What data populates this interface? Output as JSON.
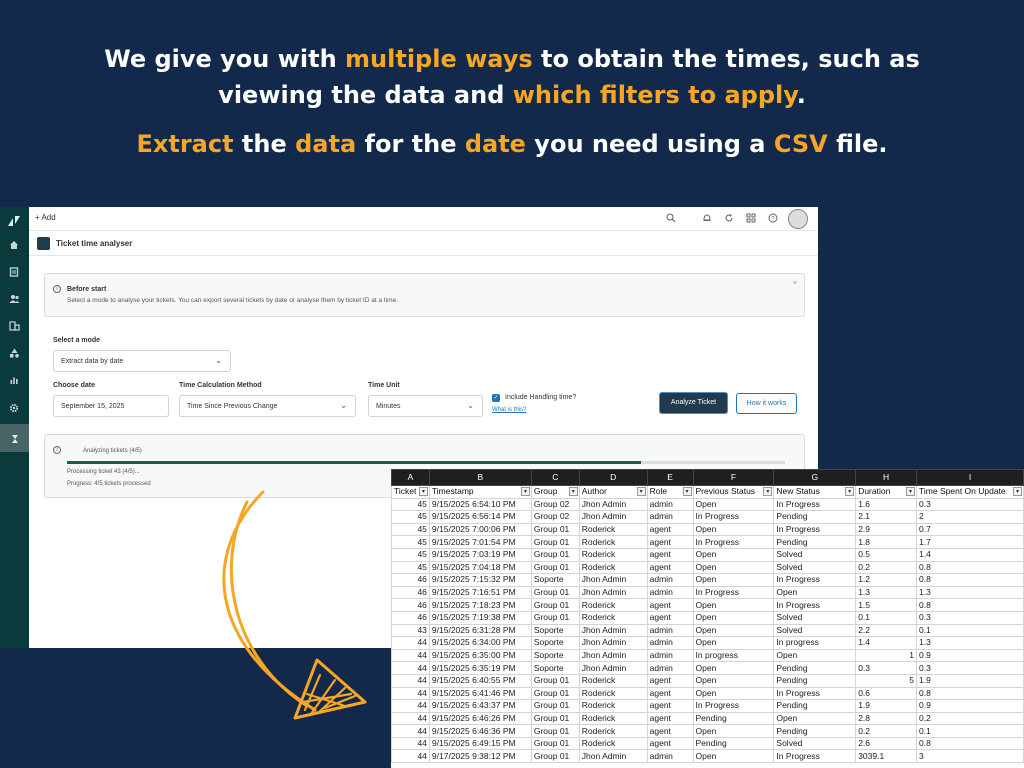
{
  "headline": {
    "line1_parts": [
      {
        "text": "We give you with ",
        "hl": false
      },
      {
        "text": "multiple ways",
        "hl": true
      },
      {
        "text": " to obtain the times, such as viewing the data and ",
        "hl": false
      },
      {
        "text": "which filters to apply",
        "hl": true
      },
      {
        "text": ".",
        "hl": false
      }
    ],
    "line2_parts": [
      {
        "text": "Extract",
        "hl": true
      },
      {
        "text": " the ",
        "hl": false
      },
      {
        "text": "data",
        "hl": true
      },
      {
        "text": " for the ",
        "hl": false
      },
      {
        "text": "date",
        "hl": true
      },
      {
        "text": " you need using a ",
        "hl": false
      },
      {
        "text": "CSV",
        "hl": true
      },
      {
        "text": " file.",
        "hl": false
      }
    ],
    "highlight_color": "#f5a623"
  },
  "app": {
    "add_label": "+ Add",
    "title": "Ticket time analyser",
    "info": {
      "title": "Before start",
      "text": "Select a mode to analyse your tickets. You can export several tickets by date or analyse them by ticket ID at a time.",
      "close": "×"
    },
    "mode": {
      "label": "Select a mode",
      "value": "Extract data by date"
    },
    "date": {
      "label": "Choose date",
      "value": "September 15, 2025"
    },
    "method": {
      "label": "Time Calculation Method",
      "value": "Time Since Previous Change"
    },
    "unit": {
      "label": "Time Unit",
      "value": "Minutes"
    },
    "handling": {
      "label": "Include Handling time?",
      "link": "What is this?",
      "checked": true
    },
    "analyze_button": "Analyze Ticket",
    "how_button": "How it works",
    "progress": {
      "title": "Analyzing tickets (4/5)",
      "processing": "Processing ticket 43 (4/5)...",
      "summary": "Progress: 4/5 tickets processed",
      "fraction": 0.8
    },
    "rail_icons": [
      "zendesk-logo-icon",
      "home-icon",
      "tickets-icon",
      "users-icon",
      "organizations-icon",
      "shapes-icon",
      "reports-icon",
      "settings-icon",
      "hourglass-app-icon"
    ],
    "top_icons": [
      "search-icon",
      "bell-icon",
      "refresh-icon",
      "apps-icon",
      "help-icon",
      "avatar"
    ]
  },
  "sheet": {
    "columns": [
      "A",
      "B",
      "C",
      "D",
      "E",
      "F",
      "G",
      "H",
      "I"
    ],
    "headers": [
      "Ticket",
      "Timestamp",
      "Group",
      "Author",
      "Role",
      "Previous Status",
      "New Status",
      "Duration",
      "Time Spent On Update"
    ],
    "rows": [
      [
        "45",
        "9/15/2025 6:54:10 PM",
        "Group 02",
        "Jhon Admin",
        "admin",
        "Open",
        "In Progress",
        "1.6",
        "0.3"
      ],
      [
        "45",
        "9/15/2025 6:56:14 PM",
        "Group 02",
        "Jhon Admin",
        "admin",
        "In Progress",
        "Pending",
        "2.1",
        "2"
      ],
      [
        "45",
        "9/15/2025 7:00:06 PM",
        "Group 01",
        "Roderick",
        "agent",
        "Open",
        "In Progress",
        "2.9",
        "0.7"
      ],
      [
        "45",
        "9/15/2025 7:01:54 PM",
        "Group 01",
        "Roderick",
        "agent",
        "In Progress",
        "Pending",
        "1.8",
        "1.7"
      ],
      [
        "45",
        "9/15/2025 7:03:19 PM",
        "Group 01",
        "Roderick",
        "agent",
        "Open",
        "Solved",
        "0.5",
        "1.4"
      ],
      [
        "45",
        "9/15/2025 7:04:18 PM",
        "Group 01",
        "Roderick",
        "agent",
        "Open",
        "Solved",
        "0.2",
        "0.8"
      ],
      [
        "46",
        "9/15/2025 7:15:32 PM",
        "Soporte",
        "Jhon Admin",
        "admin",
        "Open",
        "In Progress",
        "1.2",
        "0.8"
      ],
      [
        "46",
        "9/15/2025 7:16:51 PM",
        "Group 01",
        "Jhon Admin",
        "admin",
        "In Progress",
        "Open",
        "1.3",
        "1.3"
      ],
      [
        "46",
        "9/15/2025 7:18:23 PM",
        "Group 01",
        "Roderick",
        "agent",
        "Open",
        "In Progress",
        "1.5",
        "0.8"
      ],
      [
        "46",
        "9/15/2025 7:19:38 PM",
        "Group 01",
        "Roderick",
        "agent",
        "Open",
        "Solved",
        "0.1",
        "0.3"
      ],
      [
        "43",
        "9/15/2025 6:31:28 PM",
        "Soporte",
        "Jhon Admin",
        "admin",
        "Open",
        "Solved",
        "2.2",
        "0.1"
      ],
      [
        "44",
        "9/15/2025 6:34:00 PM",
        "Soporte",
        "Jhon Admin",
        "admin",
        "Open",
        "In progress",
        "1.4",
        "1.3"
      ],
      [
        "44",
        "9/15/2025 6:35:00 PM",
        "Soporte",
        "Jhon Admin",
        "admin",
        "In progress",
        "Open",
        "1",
        "0.9"
      ],
      [
        "44",
        "9/15/2025 6:35:19 PM",
        "Soporte",
        "Jhon Admin",
        "admin",
        "Open",
        "Pending",
        "0.3",
        "0.3"
      ],
      [
        "44",
        "9/15/2025 6:40:55 PM",
        "Group 01",
        "Roderick",
        "agent",
        "Open",
        "Pending",
        "5",
        "1.9"
      ],
      [
        "44",
        "9/15/2025 6:41:46 PM",
        "Group 01",
        "Roderick",
        "agent",
        "Open",
        "In Progress",
        "0.6",
        "0.8"
      ],
      [
        "44",
        "9/15/2025 6:43:37 PM",
        "Group 01",
        "Roderick",
        "agent",
        "In Progress",
        "Pending",
        "1.9",
        "0.9"
      ],
      [
        "44",
        "9/15/2025 6:46:26 PM",
        "Group 01",
        "Roderick",
        "agent",
        "Pending",
        "Open",
        "2.8",
        "0.2"
      ],
      [
        "44",
        "9/15/2025 6:46:36 PM",
        "Group 01",
        "Roderick",
        "agent",
        "Open",
        "Pending",
        "0.2",
        "0.1"
      ],
      [
        "44",
        "9/15/2025 6:49:15 PM",
        "Group 01",
        "Roderick",
        "agent",
        "Pending",
        "Solved",
        "2.6",
        "0.8"
      ],
      [
        "44",
        "9/17/2025 9:38:12 PM",
        "Group 01",
        "Jhon Admin",
        "admin",
        "Open",
        "In Progress",
        "3039.1",
        "3"
      ]
    ],
    "h_right_aligned_rows": [
      12,
      14
    ]
  },
  "colors": {
    "background": "#13294b",
    "accent": "#f5a623",
    "rail": "#0b3a3d",
    "primary_button": "#1f3b4d",
    "progress_fill": "#186146",
    "arrow": "#f5a623"
  }
}
